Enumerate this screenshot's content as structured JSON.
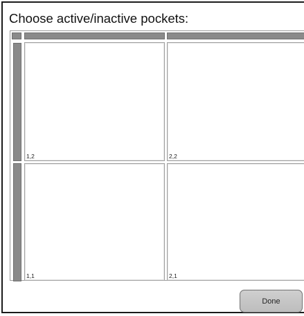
{
  "dialog": {
    "title": "Choose active/inactive pockets:"
  },
  "grid": {
    "cells": [
      {
        "row": 1,
        "col": 1,
        "label": "1,2"
      },
      {
        "row": 1,
        "col": 2,
        "label": "2,2"
      },
      {
        "row": 2,
        "col": 1,
        "label": "1,1"
      },
      {
        "row": 2,
        "col": 2,
        "label": "2,1"
      }
    ]
  },
  "footer": {
    "done_label": "Done"
  },
  "colors": {
    "header_fill": "#8a8a8a",
    "button_fill": "#c6c6c6",
    "window_border": "#1a1a1a"
  }
}
